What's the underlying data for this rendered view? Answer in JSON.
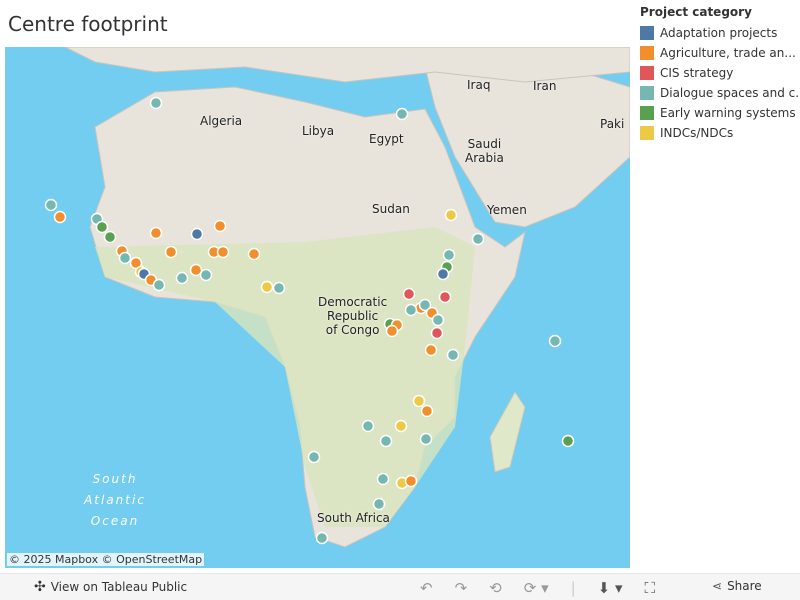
{
  "title": "Centre footprint",
  "legend": {
    "title": "Project category",
    "items": [
      {
        "label": "Adaptation projects",
        "color": "#4e79a7"
      },
      {
        "label": "Agriculture, trade an...",
        "color": "#f28e2b"
      },
      {
        "label": "CIS strategy",
        "color": "#e15759"
      },
      {
        "label": "Dialogue spaces and c...",
        "color": "#76b7b2"
      },
      {
        "label": "Early warning systems",
        "color": "#59a14f"
      },
      {
        "label": "INDCs/NDCs",
        "color": "#edc948"
      }
    ]
  },
  "map_labels": {
    "algeria": "Algeria",
    "libya": "Libya",
    "egypt": "Egypt",
    "sudan": "Sudan",
    "iraq": "Iraq",
    "iran": "Iran",
    "pakistan": "Paki",
    "saudi": "Saudi\nArabia",
    "yemen": "Yemen",
    "drc": "Democratic\nRepublic\nof Congo",
    "south_africa": "South Africa",
    "ocean": "South\nAtlantic\nOcean"
  },
  "markers": [
    "D",
    "D",
    "D",
    "G",
    "D",
    "E",
    "E",
    "G",
    "A",
    "G",
    "G",
    "D",
    "G",
    "I",
    "A",
    "G",
    "D",
    "G",
    "D",
    "G",
    "D",
    "G",
    "G",
    "G",
    "I",
    "D",
    "I",
    "D",
    "D",
    "E",
    "A",
    "C",
    "G",
    "D",
    "D",
    "C",
    "G",
    "D",
    "E",
    "G",
    "G",
    "C",
    "G",
    "D",
    "D",
    "E",
    "I",
    "G",
    "I",
    "D",
    "D",
    "D",
    "D",
    "D",
    "I",
    "G",
    "D",
    "D"
  ],
  "attribution": "© 2025 Mapbox  © OpenStreetMap",
  "toolbar": {
    "view": "View on Tableau Public",
    "share": "Share"
  }
}
